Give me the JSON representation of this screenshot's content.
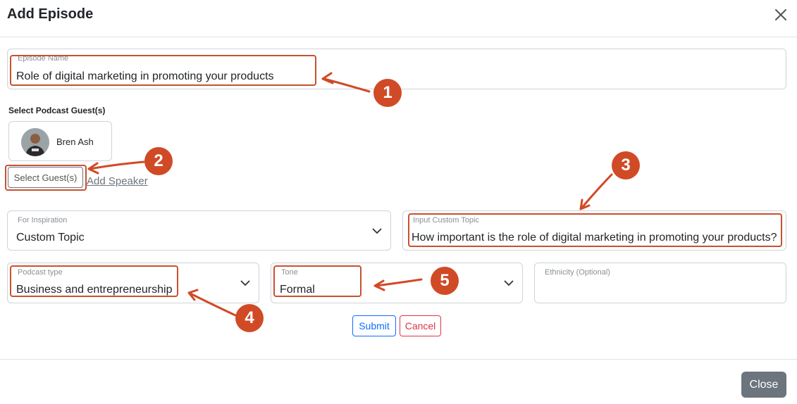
{
  "dialog": {
    "title": "Add Episode",
    "close_label": "Close"
  },
  "episode_name": {
    "label": "Episode Name",
    "value": "Role of digital marketing in promoting your products"
  },
  "guests": {
    "section_label": "Select Podcast Guest(s)",
    "selected": [
      {
        "name": "Bren Ash"
      }
    ],
    "select_button_label": "Select Guest(s)",
    "add_speaker_label": "Add Speaker"
  },
  "inspiration": {
    "label": "For Inspiration",
    "value": "Custom Topic"
  },
  "custom_topic": {
    "label": "Input Custom Topic",
    "value": "How important is the role of digital marketing in promoting your products?"
  },
  "podcast_type": {
    "label": "Podcast type",
    "value": "Business and entrepreneurship"
  },
  "tone": {
    "label": "Tone",
    "value": "Formal"
  },
  "ethnicity": {
    "label": "Ethnicity (Optional)",
    "value": ""
  },
  "actions": {
    "submit_label": "Submit",
    "cancel_label": "Cancel"
  },
  "annotations": {
    "color": "#c8512f",
    "badges": [
      "1",
      "2",
      "3",
      "4",
      "5"
    ]
  }
}
